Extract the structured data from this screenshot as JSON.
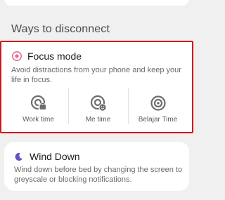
{
  "section": {
    "title": "Ways to disconnect"
  },
  "focus_mode": {
    "title": "Focus mode",
    "icon": "focus-target-icon",
    "description": "Avoid distractions from your phone and keep your life in focus.",
    "modes": [
      {
        "label": "Work time",
        "icon": "work-time-icon"
      },
      {
        "label": "Me time",
        "icon": "me-time-icon"
      },
      {
        "label": "Belajar Time",
        "icon": "target-icon"
      }
    ]
  },
  "wind_down": {
    "title": "Wind Down",
    "icon": "moon-icon",
    "description": "Wind down before bed by changing the screen to greyscale or blocking notifications."
  },
  "colors": {
    "focus_accent": "#e5708e",
    "moon_accent": "#6a4fc4",
    "highlight_border": "#d0171c",
    "icon_gray": "#6d6d6d"
  }
}
